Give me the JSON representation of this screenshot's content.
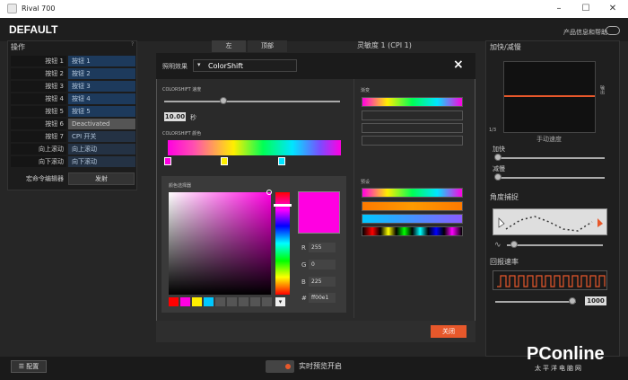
{
  "window": {
    "title": "Rival 700"
  },
  "header": {
    "profile": "DEFAULT",
    "help_link": "产品信息和帮助"
  },
  "buttons_panel": {
    "title": "操作",
    "rows": [
      {
        "label": "按钮 1",
        "value": "按钮 1"
      },
      {
        "label": "按钮 2",
        "value": "按钮 2"
      },
      {
        "label": "按钮 3",
        "value": "按钮 3"
      },
      {
        "label": "按钮 4",
        "value": "按钮 4"
      },
      {
        "label": "按钮 5",
        "value": "按钮 5"
      },
      {
        "label": "按钮 6",
        "value": "Deactivated"
      },
      {
        "label": "按钮 7",
        "value": "CPI 开关"
      },
      {
        "label": "向上滚动",
        "value": "向上滚动"
      },
      {
        "label": "向下滚动",
        "value": "向下滚动"
      }
    ],
    "macro_label": "宏命令编辑器",
    "macro_button": "发射"
  },
  "tabs": {
    "left": "左",
    "top": "顶部"
  },
  "cpi": {
    "label": "灵敏度 1 (CPI 1)"
  },
  "right_panel": {
    "accel_title": "加快/减慢",
    "axis_label": "手动速度",
    "accel": "加快",
    "decel": "减慢",
    "angle_title": "角度捕捉",
    "polling_title": "回报速率",
    "polling_value": "1000",
    "graph_y_label": "输出",
    "graph_corner": "1/3"
  },
  "dialog": {
    "label": "照明效果",
    "effect": "ColorShift",
    "close": "×",
    "speed_label": "COLORSHIFT 速度",
    "speed_value": "10.00",
    "speed_unit": "秒",
    "colors_label": "COLORSHIFT 颜色",
    "picker_label": "颜色选择器",
    "rgb": {
      "r_label": "R",
      "r": "255",
      "g_label": "G",
      "g": "0",
      "b_label": "B",
      "b": "225",
      "hex_label": "#",
      "hex": "ff00e1"
    },
    "gradient_title": "渐变",
    "preset_title": "预设",
    "close_button": "关闭"
  },
  "footer": {
    "config": "配置",
    "preview": "实时预览开启"
  },
  "watermark": {
    "brand": "PConline",
    "sub": "太平洋电脑网"
  },
  "colors": {
    "accent": "#e7582b",
    "selected": "#ff00e1"
  }
}
